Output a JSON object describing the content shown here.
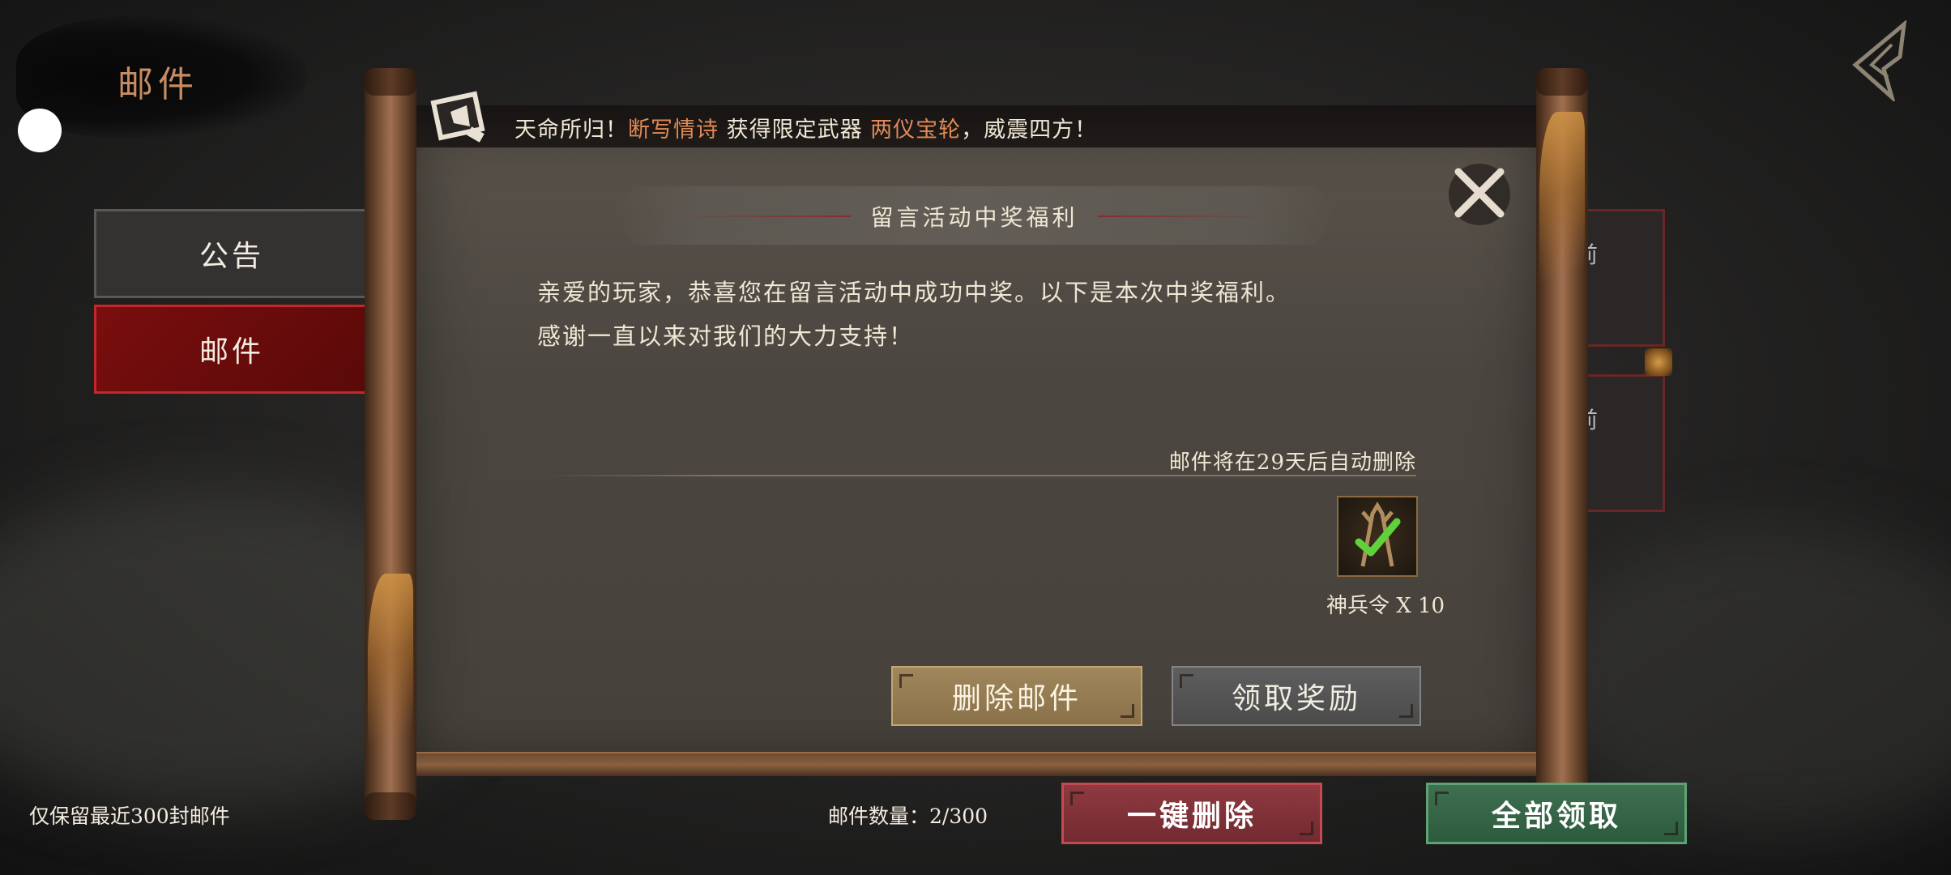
{
  "header": {
    "title": "邮件"
  },
  "nav": {
    "tabs": [
      {
        "label": "公告",
        "active": false
      },
      {
        "label": "邮件",
        "active": true
      }
    ]
  },
  "announcement": {
    "prefix": "天命所归！",
    "player": "断写情诗",
    "middle": " 获得限定武器 ",
    "weapon": "两仪宝轮",
    "suffix": "，威震四方！"
  },
  "mail": {
    "title": "留言活动中奖福利",
    "body_line1": "亲爱的玩家，恭喜您在留言活动中成功中奖。以下是本次中奖福利。",
    "body_line2": "感谢一直以来对我们的大力支持！",
    "expiry": "邮件将在29天后自动删除",
    "reward": {
      "name": "神兵令",
      "quantity_label": "神兵令 X 10",
      "claimed": true,
      "icon": "weapon-token-icon"
    },
    "delete_label": "删除邮件",
    "claim_label": "领取奖励"
  },
  "background_cards": {
    "card1_text": "前",
    "card2_text": "前"
  },
  "footer": {
    "note": "仅保留最近300封邮件",
    "count_label": "邮件数量：2/300",
    "delete_all_label": "一键删除",
    "claim_all_label": "全部领取"
  },
  "colors": {
    "highlight": "#e08a56",
    "title_accent": "#c98c62",
    "active_tab": "#7a0e0e",
    "delete_all": "#8e3a40",
    "claim_all": "#3e7050"
  }
}
